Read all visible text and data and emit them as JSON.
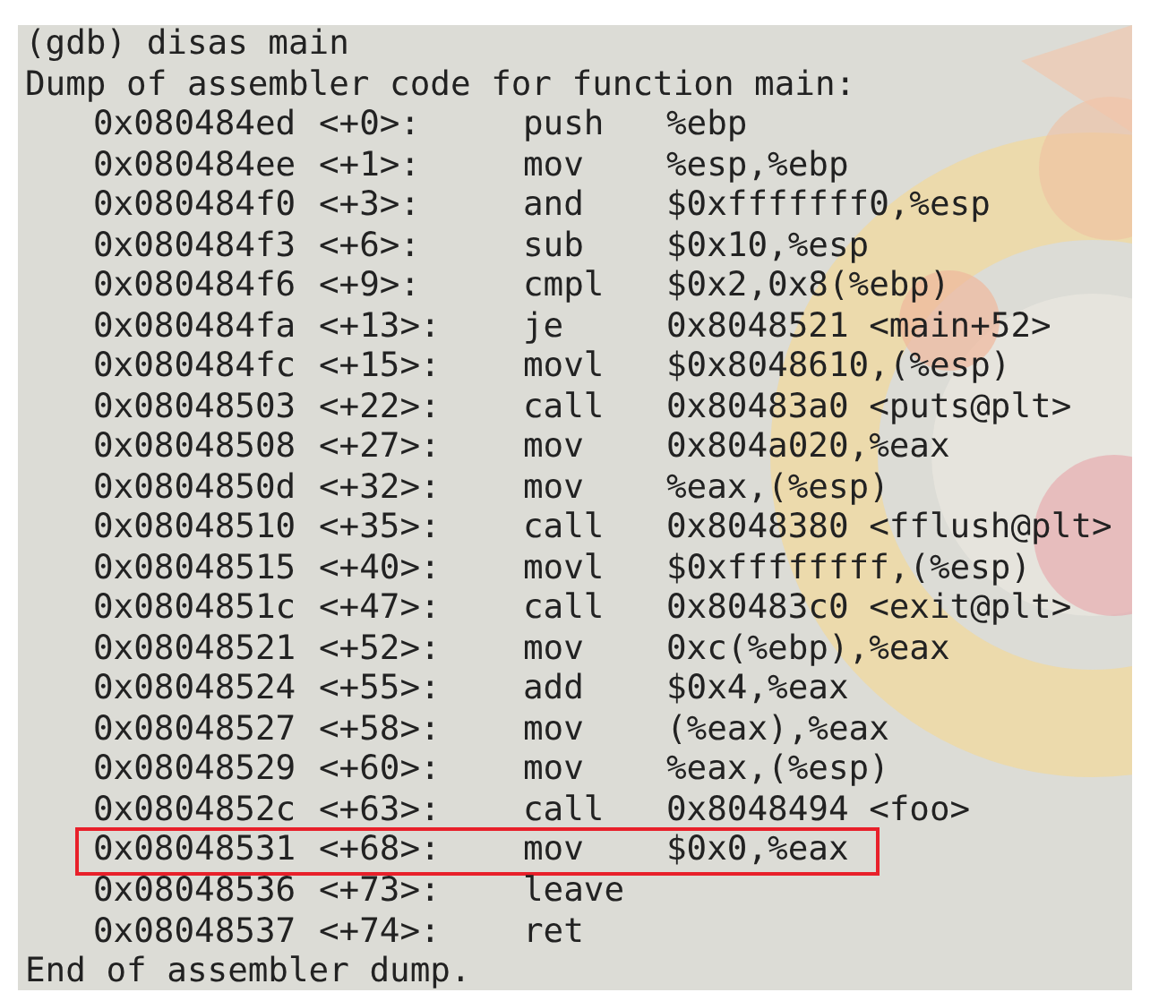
{
  "terminal": {
    "command_line": "(gdb) disas main",
    "header": "Dump of assembler code for function main:",
    "rows": [
      {
        "address": "0x080484ed",
        "offset": "<+0>:",
        "mnemonic": "push",
        "operands": "%ebp",
        "highlighted": false
      },
      {
        "address": "0x080484ee",
        "offset": "<+1>:",
        "mnemonic": "mov",
        "operands": "%esp,%ebp",
        "highlighted": false
      },
      {
        "address": "0x080484f0",
        "offset": "<+3>:",
        "mnemonic": "and",
        "operands": "$0xfffffff0,%esp",
        "highlighted": false
      },
      {
        "address": "0x080484f3",
        "offset": "<+6>:",
        "mnemonic": "sub",
        "operands": "$0x10,%esp",
        "highlighted": false
      },
      {
        "address": "0x080484f6",
        "offset": "<+9>:",
        "mnemonic": "cmpl",
        "operands": "$0x2,0x8(%ebp)",
        "highlighted": false
      },
      {
        "address": "0x080484fa",
        "offset": "<+13>:",
        "mnemonic": "je",
        "operands": "0x8048521 <main+52>",
        "highlighted": false
      },
      {
        "address": "0x080484fc",
        "offset": "<+15>:",
        "mnemonic": "movl",
        "operands": "$0x8048610,(%esp)",
        "highlighted": false
      },
      {
        "address": "0x08048503",
        "offset": "<+22>:",
        "mnemonic": "call",
        "operands": "0x80483a0 <puts@plt>",
        "highlighted": false
      },
      {
        "address": "0x08048508",
        "offset": "<+27>:",
        "mnemonic": "mov",
        "operands": "0x804a020,%eax",
        "highlighted": false
      },
      {
        "address": "0x0804850d",
        "offset": "<+32>:",
        "mnemonic": "mov",
        "operands": "%eax,(%esp)",
        "highlighted": false
      },
      {
        "address": "0x08048510",
        "offset": "<+35>:",
        "mnemonic": "call",
        "operands": "0x8048380 <fflush@plt>",
        "highlighted": false
      },
      {
        "address": "0x08048515",
        "offset": "<+40>:",
        "mnemonic": "movl",
        "operands": "$0xffffffff,(%esp)",
        "highlighted": false
      },
      {
        "address": "0x0804851c",
        "offset": "<+47>:",
        "mnemonic": "call",
        "operands": "0x80483c0 <exit@plt>",
        "highlighted": false
      },
      {
        "address": "0x08048521",
        "offset": "<+52>:",
        "mnemonic": "mov",
        "operands": "0xc(%ebp),%eax",
        "highlighted": false
      },
      {
        "address": "0x08048524",
        "offset": "<+55>:",
        "mnemonic": "add",
        "operands": "$0x4,%eax",
        "highlighted": false
      },
      {
        "address": "0x08048527",
        "offset": "<+58>:",
        "mnemonic": "mov",
        "operands": "(%eax),%eax",
        "highlighted": false
      },
      {
        "address": "0x08048529",
        "offset": "<+60>:",
        "mnemonic": "mov",
        "operands": "%eax,(%esp)",
        "highlighted": false
      },
      {
        "address": "0x0804852c",
        "offset": "<+63>:",
        "mnemonic": "call",
        "operands": "0x8048494 <foo>",
        "highlighted": false
      },
      {
        "address": "0x08048531",
        "offset": "<+68>:",
        "mnemonic": "mov",
        "operands": "$0x0,%eax",
        "highlighted": true
      },
      {
        "address": "0x08048536",
        "offset": "<+73>:",
        "mnemonic": "leave",
        "highlighted": false
      },
      {
        "address": "0x08048537",
        "offset": "<+74>:",
        "mnemonic": "ret",
        "highlighted": false
      }
    ],
    "footer": "End of assembler dump."
  }
}
